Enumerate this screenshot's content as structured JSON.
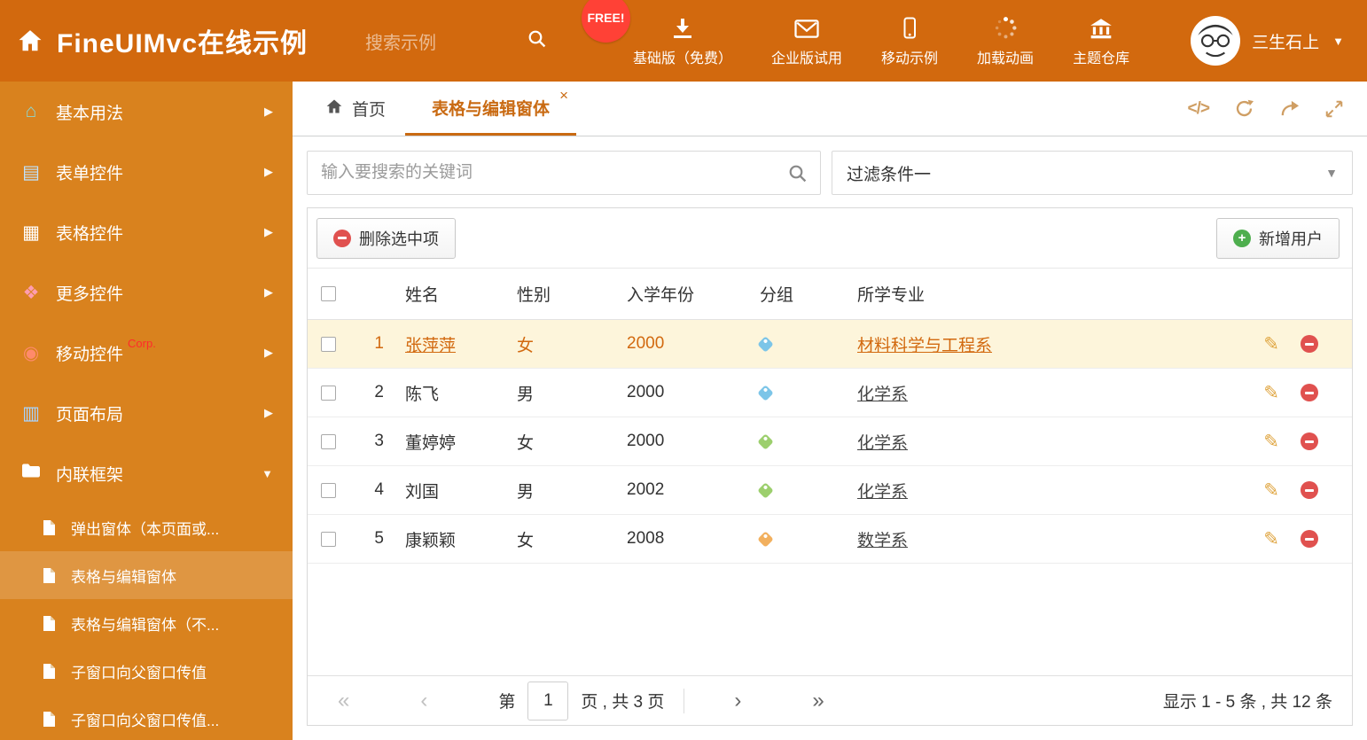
{
  "colors": {
    "header_bg": "#d2690e",
    "sidebar_bg": "#d9821e",
    "accent": "#c96a12",
    "highlight_row_bg": "#fdf5db",
    "free_badge_bg": "#ff4136",
    "tag_blue": "#7cc5e8",
    "tag_green": "#9ccf6d",
    "tag_orange": "#f2b05e",
    "delete_red": "#e0514f",
    "add_green": "#4eae4e"
  },
  "header": {
    "title": "FineUIMvc在线示例",
    "search_placeholder": "搜索示例",
    "free_badge": "FREE!",
    "nav": [
      {
        "label": "基础版（免费）"
      },
      {
        "label": "企业版试用"
      },
      {
        "label": "移动示例"
      },
      {
        "label": "加载动画"
      },
      {
        "label": "主题仓库"
      }
    ],
    "username": "三生石上"
  },
  "sidebar": {
    "items": [
      {
        "label": "基本用法"
      },
      {
        "label": "表单控件"
      },
      {
        "label": "表格控件"
      },
      {
        "label": "更多控件"
      },
      {
        "label": "移动控件",
        "badge": "Corp."
      },
      {
        "label": "页面布局"
      },
      {
        "label": "内联框架"
      }
    ],
    "subitems": [
      {
        "label": "弹出窗体（本页面或..."
      },
      {
        "label": "表格与编辑窗体"
      },
      {
        "label": "表格与编辑窗体（不..."
      },
      {
        "label": "子窗口向父窗口传值"
      },
      {
        "label": "子窗口向父窗口传值..."
      }
    ]
  },
  "tabs": {
    "home": "首页",
    "active": "表格与编辑窗体",
    "close": "×"
  },
  "filters": {
    "search_placeholder": "输入要搜索的关键词",
    "filter_selected": "过滤条件一"
  },
  "toolbar": {
    "delete_label": "删除选中项",
    "add_label": "新增用户"
  },
  "table": {
    "headers": {
      "name": "姓名",
      "gender": "性别",
      "year": "入学年份",
      "group": "分组",
      "major": "所学专业"
    },
    "rows": [
      {
        "num": "1",
        "name": "张萍萍",
        "gender": "女",
        "year": "2000",
        "tag": "blue",
        "major": "材料科学与工程系"
      },
      {
        "num": "2",
        "name": "陈飞",
        "gender": "男",
        "year": "2000",
        "tag": "blue",
        "major": "化学系"
      },
      {
        "num": "3",
        "name": "董婷婷",
        "gender": "女",
        "year": "2000",
        "tag": "green",
        "major": "化学系"
      },
      {
        "num": "4",
        "name": "刘国",
        "gender": "男",
        "year": "2002",
        "tag": "green",
        "major": "化学系"
      },
      {
        "num": "5",
        "name": "康颖颖",
        "gender": "女",
        "year": "2008",
        "tag": "orange",
        "major": "数学系"
      }
    ]
  },
  "pagination": {
    "page_prefix": "第",
    "page_value": "1",
    "page_suffix": "页 , 共 3 页",
    "summary": "显示 1 - 5 条 , 共 12 条"
  }
}
